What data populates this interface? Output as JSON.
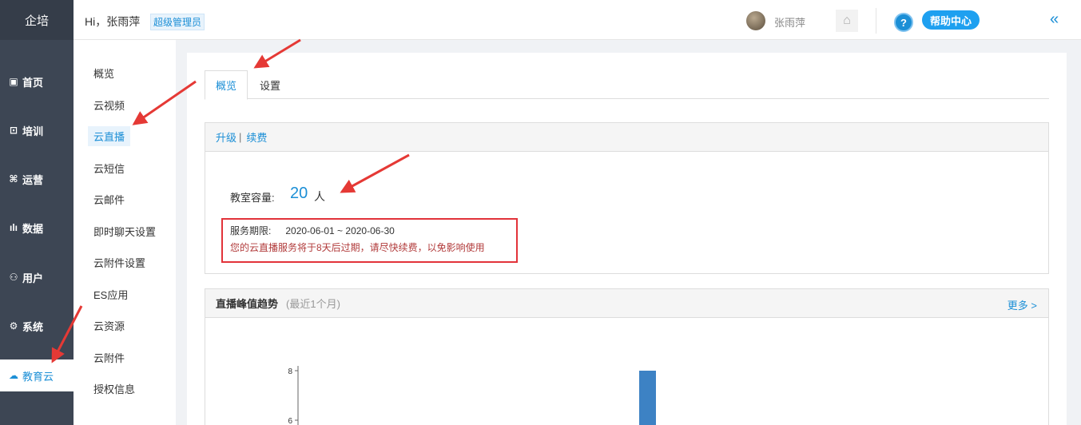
{
  "brand": "企培",
  "nav": [
    {
      "label": "首页",
      "icon": "dashboard-icon",
      "glyph": "▣"
    },
    {
      "label": "培训",
      "icon": "training-icon",
      "glyph": "⊡"
    },
    {
      "label": "运营",
      "icon": "operations-icon",
      "glyph": "⌘"
    },
    {
      "label": "数据",
      "icon": "chart-icon",
      "glyph": "ılı"
    },
    {
      "label": "用户",
      "icon": "user-icon",
      "glyph": "⚇"
    },
    {
      "label": "系统",
      "icon": "gear-icon",
      "glyph": "⚙"
    },
    {
      "label": "教育云",
      "icon": "cloud-icon",
      "glyph": "☁"
    }
  ],
  "submenu": [
    "概览",
    "云视频",
    "云直播",
    "云短信",
    "云邮件",
    "即时聊天设置",
    "云附件设置",
    "ES应用",
    "云资源",
    "云附件",
    "授权信息"
  ],
  "topbar": {
    "greeting": "Hi，张雨萍",
    "role": "超级管理员",
    "username": "张雨萍",
    "help": "帮助中心"
  },
  "tabs": [
    "概览",
    "设置"
  ],
  "upgrade_card": {
    "upgrade": "升级",
    "separator": "|",
    "renew": "续费",
    "capacity_label": "教室容量:",
    "capacity_value": "20",
    "capacity_unit": "人",
    "service_label": "服务期限:",
    "service_period": "2020-06-01 ~ 2020-06-30",
    "warning": "您的云直播服务将于8天后过期，请尽快续费，以免影响使用"
  },
  "trend_card": {
    "title": "直播峰值趋势",
    "subtitle": "(最近1个月)",
    "more": "更多 >"
  },
  "chart_data": {
    "type": "bar",
    "title": "",
    "visible_yticks": [
      "8",
      "6"
    ],
    "values": [
      8
    ],
    "color": "#3d82c4"
  }
}
